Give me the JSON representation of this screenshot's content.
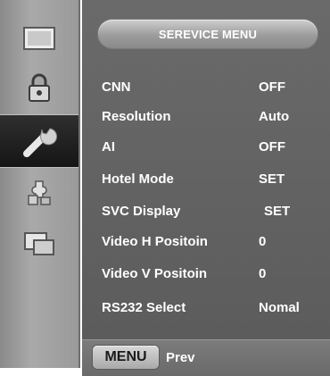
{
  "title": "SEREVICE MENU",
  "items": [
    {
      "label": "CNN",
      "value": "OFF"
    },
    {
      "label": "Resolution",
      "value": "Auto"
    },
    {
      "label": "AI",
      "value": "OFF"
    },
    {
      "label": "Hotel Mode",
      "value": "SET"
    },
    {
      "label": "SVC Display",
      "value": "SET"
    },
    {
      "label": "Video H Positoin",
      "value": "0"
    },
    {
      "label": "Video V Positoin",
      "value": "0"
    },
    {
      "label": "RS232 Select",
      "value": "Nomal"
    }
  ],
  "footer": {
    "button_label": "MENU",
    "action_label": "Prev"
  },
  "sidebar": [
    "screen-icon",
    "lock-icon",
    "wrench-icon",
    "puzzle-icon",
    "pip-icon"
  ],
  "colors": {
    "panel": "#5f5f5f",
    "sidebar": "#a0a0a0",
    "active": "#1e1e1e",
    "text": "#ffffff"
  }
}
